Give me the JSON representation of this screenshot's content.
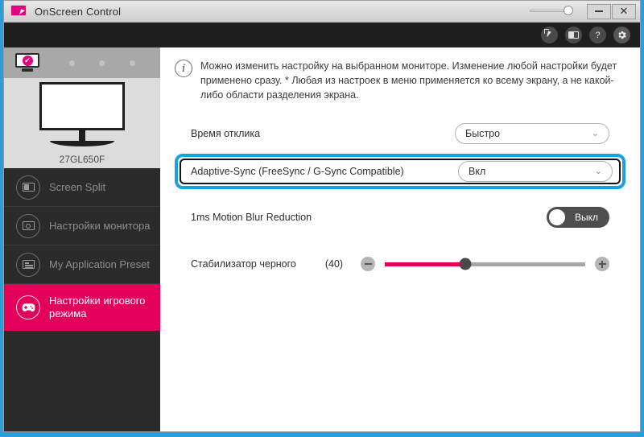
{
  "window": {
    "title": "OnScreen Control",
    "app_icon": "monitor-cursor-icon",
    "minimize_label": "–",
    "close_label": "✕",
    "opacity_slider_name": "window-opacity-slider"
  },
  "toolbar": {
    "icons": [
      {
        "name": "pointer-icon",
        "label": ""
      },
      {
        "name": "screen-icon",
        "label": ""
      },
      {
        "name": "help-icon",
        "label": "?"
      },
      {
        "name": "gear-icon",
        "label": ""
      }
    ]
  },
  "sidebar": {
    "monitor_selector": {
      "selected_name": "monitor-thumb-selected",
      "check_glyph": "✔",
      "dots": 3
    },
    "monitor_preview": {
      "model": "27GL650F"
    },
    "items": [
      {
        "label": "Screen Split",
        "icon": "screen-split-icon",
        "active": false
      },
      {
        "label": "Настройки монитора",
        "icon": "monitor-settings-icon",
        "active": false
      },
      {
        "label": "My Application Preset",
        "icon": "application-preset-icon",
        "active": false
      },
      {
        "label": "Настройки игрового режима",
        "icon": "gamepad-icon",
        "active": true
      }
    ]
  },
  "main": {
    "info": {
      "icon": "info-icon",
      "text": "Можно изменить настройку на выбранном мониторе. Изменение любой настройки будет применено сразу.\n* Любая из настроек в меню применяется ко всему экрану, а не какой-либо области разделения экрана."
    },
    "response_time": {
      "label": "Время отклика",
      "value": "Быстро",
      "caret": "⌄"
    },
    "adaptive_sync": {
      "label": "Adaptive-Sync (FreeSync / G-Sync Compatible)",
      "value": "Вкл",
      "caret": "⌄",
      "highlighted": true,
      "highlight_color": "#1a9fe0"
    },
    "motion_blur": {
      "label": "1ms Motion Blur Reduction",
      "state_label": "Выкл",
      "on": false
    },
    "black_stabilizer": {
      "label": "Стабилизатор черного",
      "value_label": "(40)",
      "value": 40,
      "min": 0,
      "max": 100,
      "minus_label": "−",
      "plus_label": "+",
      "fill_color": "#e4005a"
    }
  }
}
